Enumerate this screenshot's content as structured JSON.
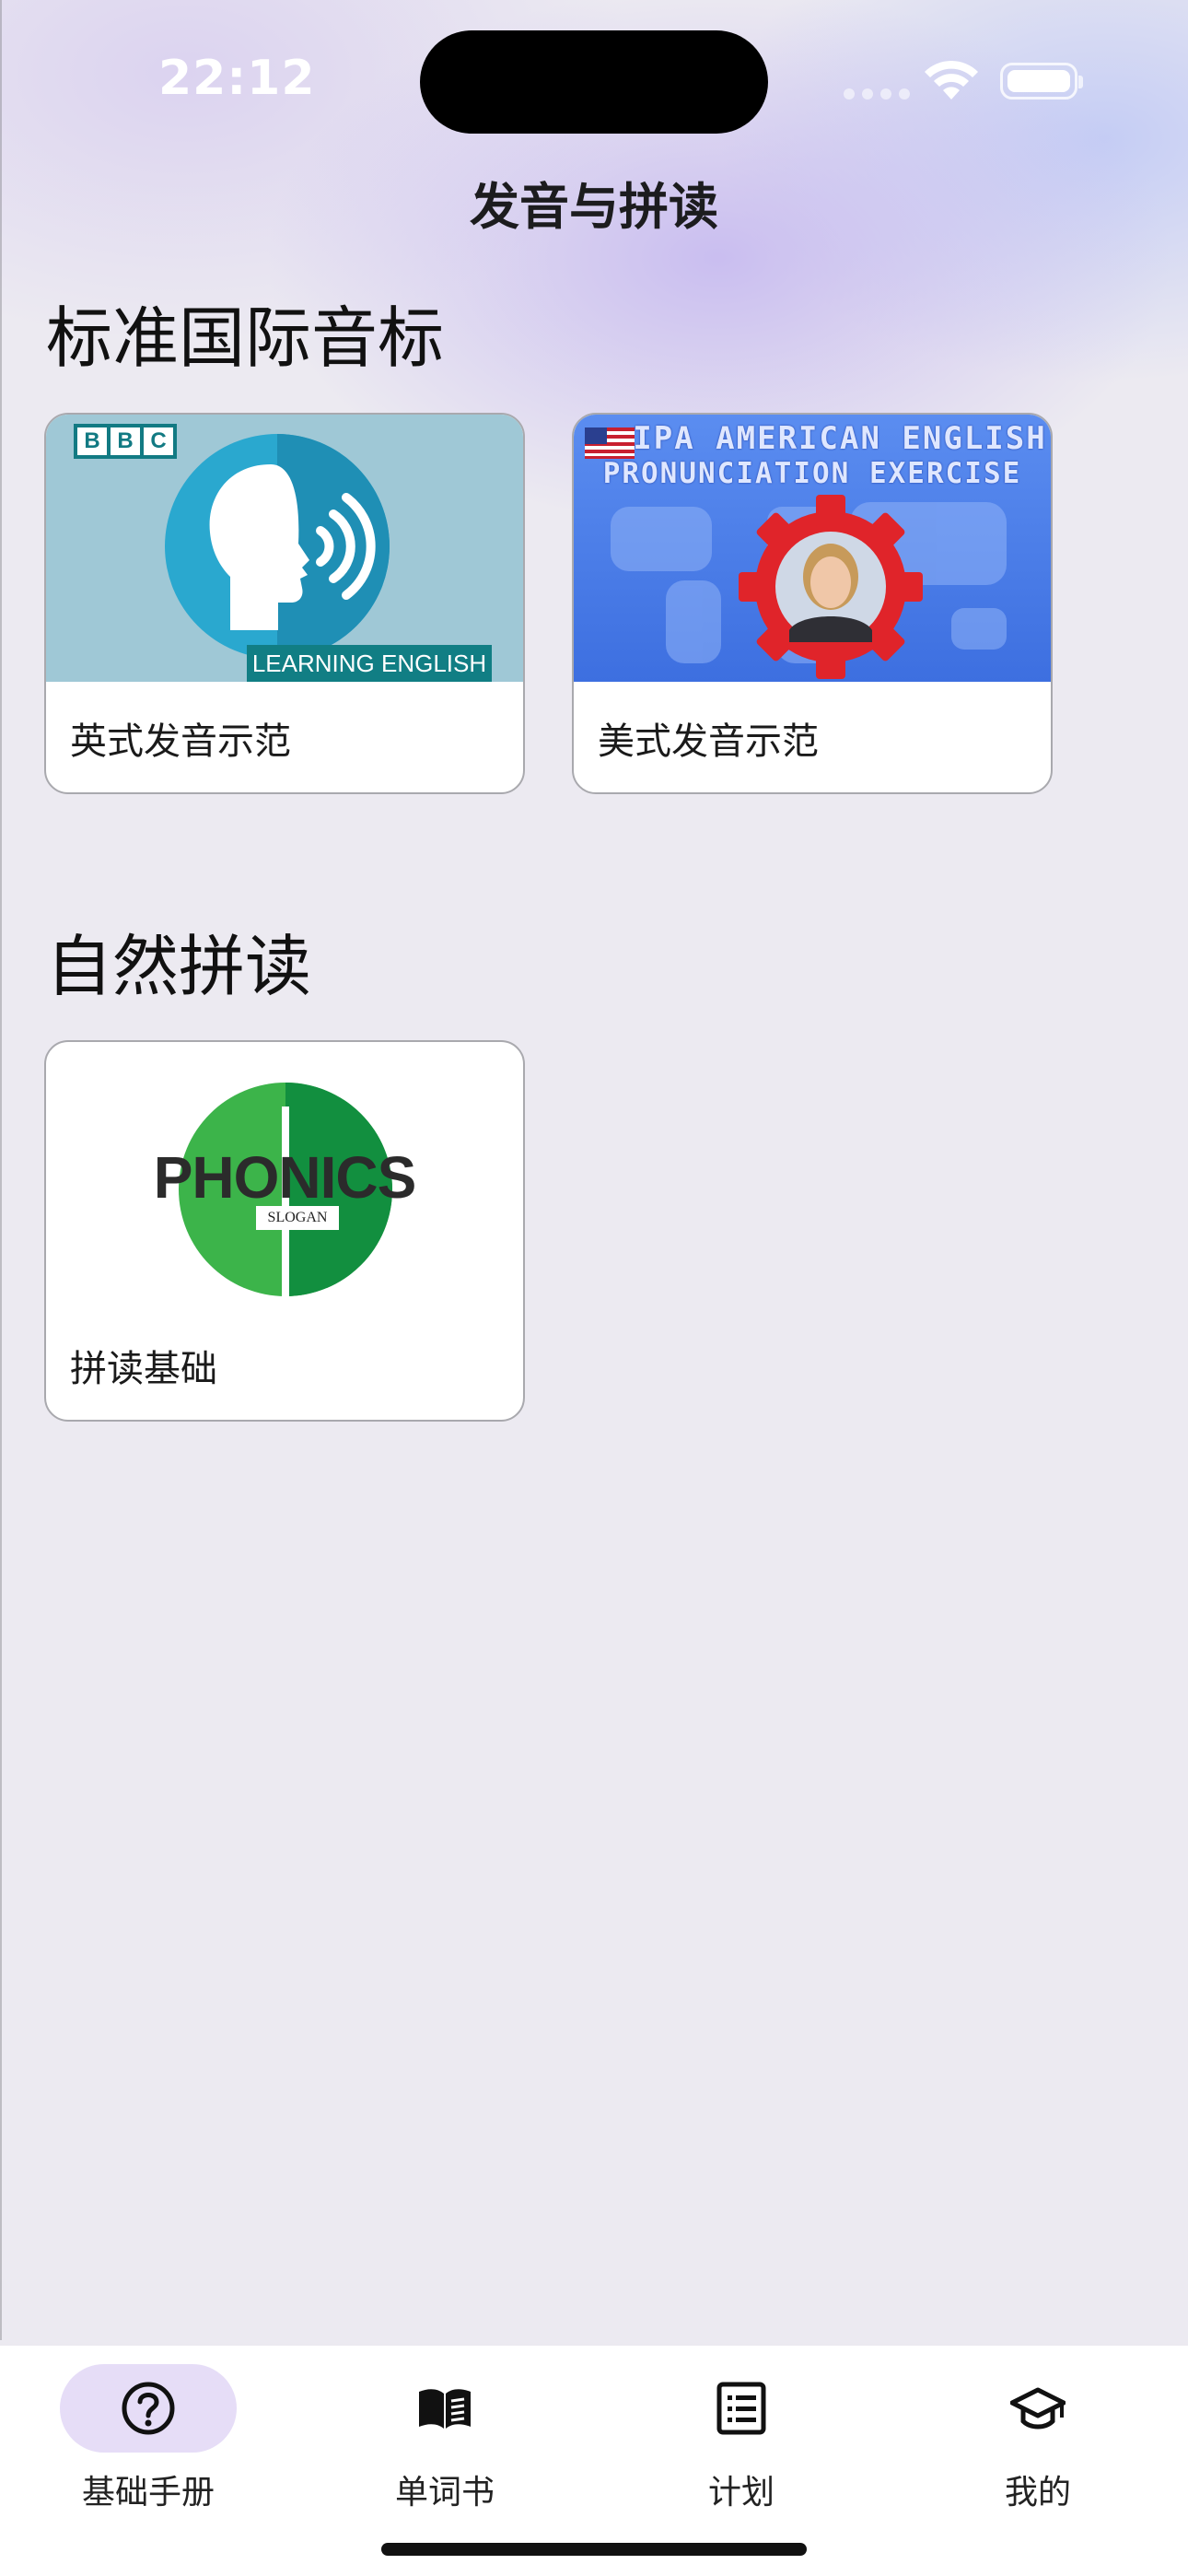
{
  "status_bar": {
    "time": "22:12"
  },
  "nav": {
    "title": "发音与拼读"
  },
  "sections": [
    {
      "title": "标准国际音标",
      "cards": [
        {
          "caption": "英式发音示范",
          "thumb_badge": "BBC",
          "thumb_band": "LEARNING ENGLISH"
        },
        {
          "caption": "美式发音示范",
          "thumb_line1": "IPA AMERICAN ENGLISH",
          "thumb_line2": "PRONUNCIATION EXERCISE"
        }
      ]
    },
    {
      "title": "自然拼读",
      "cards": [
        {
          "caption": "拼读基础",
          "thumb_word": "PHONICS",
          "thumb_slogan": "SLOGAN"
        }
      ]
    }
  ],
  "tabbar": {
    "tabs": [
      {
        "label": "基础手册",
        "icon": "question-circle-icon",
        "active": true
      },
      {
        "label": "单词书",
        "icon": "book-icon",
        "active": false
      },
      {
        "label": "计划",
        "icon": "list-icon",
        "active": false
      },
      {
        "label": "我的",
        "icon": "graduation-cap-icon",
        "active": false
      }
    ]
  },
  "colors": {
    "tab_active_pill": "#e6ddf7",
    "bbc_teal": "#127a83",
    "phonics_green": "#3cb44a",
    "gear_red": "#e0242a"
  }
}
